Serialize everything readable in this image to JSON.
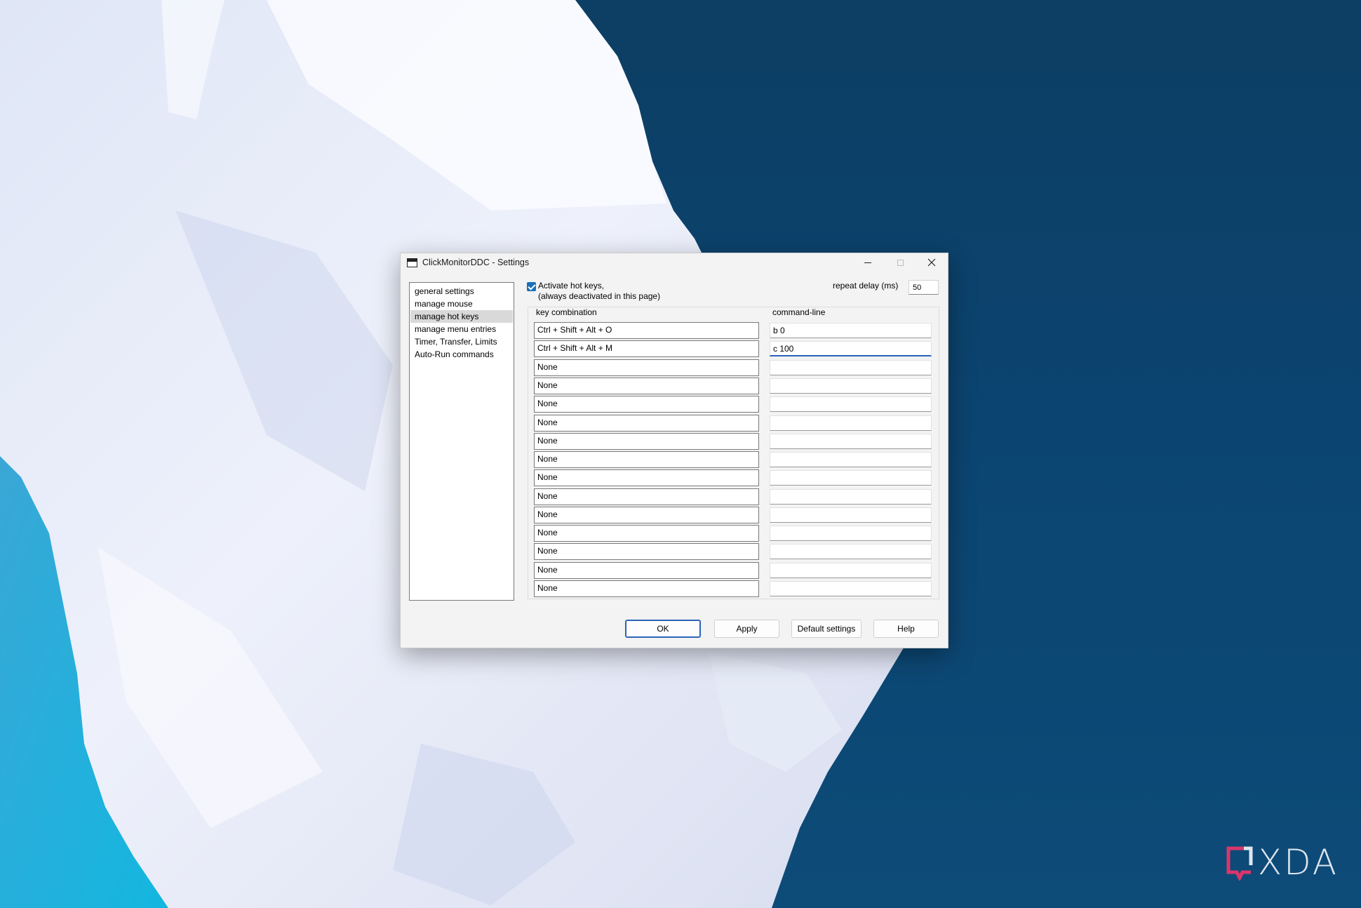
{
  "window": {
    "title": "ClickMonitorDDC - Settings"
  },
  "nav": {
    "items": [
      {
        "label": "general settings",
        "selected": false
      },
      {
        "label": "manage mouse",
        "selected": false
      },
      {
        "label": "manage hot keys",
        "selected": true
      },
      {
        "label": "manage menu entries",
        "selected": false
      },
      {
        "label": "Timer, Transfer, Limits",
        "selected": false
      },
      {
        "label": "Auto-Run commands",
        "selected": false
      }
    ]
  },
  "hotkeys": {
    "activate_checked": true,
    "activate_label_line1": "Activate hot keys,",
    "activate_label_line2": "(always deactivated in this page)",
    "repeat_delay_label": "repeat delay (ms)",
    "repeat_delay_value": "50",
    "col_key_header": "key combination",
    "col_cmd_header": "command-line",
    "rows": [
      {
        "key": "Ctrl + Shift + Alt + O",
        "cmd": "b 0"
      },
      {
        "key": "Ctrl + Shift + Alt + M",
        "cmd": "c 100",
        "focused": true
      },
      {
        "key": "None",
        "cmd": ""
      },
      {
        "key": "None",
        "cmd": ""
      },
      {
        "key": "None",
        "cmd": ""
      },
      {
        "key": "None",
        "cmd": ""
      },
      {
        "key": "None",
        "cmd": ""
      },
      {
        "key": "None",
        "cmd": ""
      },
      {
        "key": "None",
        "cmd": ""
      },
      {
        "key": "None",
        "cmd": ""
      },
      {
        "key": "None",
        "cmd": ""
      },
      {
        "key": "None",
        "cmd": ""
      },
      {
        "key": "None",
        "cmd": ""
      },
      {
        "key": "None",
        "cmd": ""
      },
      {
        "key": "None",
        "cmd": ""
      }
    ]
  },
  "buttons": {
    "ok": "OK",
    "apply": "Apply",
    "default": "Default settings",
    "help": "Help"
  },
  "branding": {
    "logo_text": "XDA"
  },
  "colors": {
    "accent": "#2b63b8",
    "checkbox": "#1a6fb8",
    "ocean": "#0b4470"
  },
  "icons": {
    "app": "window-icon",
    "minimize": "minimize-icon",
    "maximize": "maximize-icon",
    "close": "close-icon",
    "check": "checkmark-icon"
  }
}
